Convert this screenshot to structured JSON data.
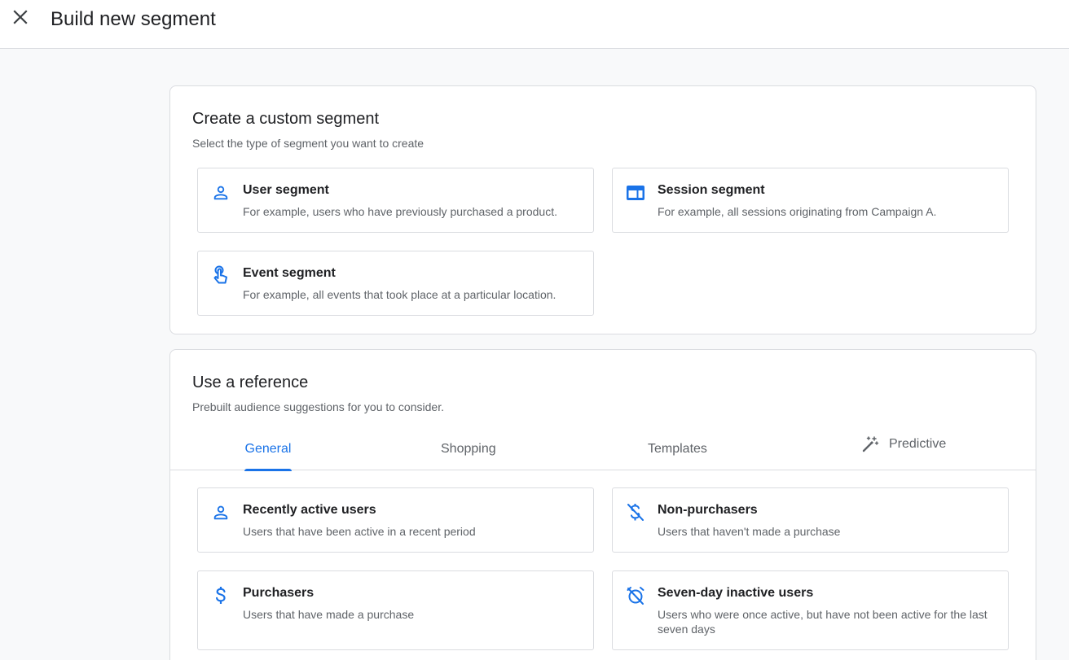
{
  "header": {
    "title": "Build new segment",
    "close_icon": "close-icon"
  },
  "custom": {
    "title": "Create a custom segment",
    "subtitle": "Select the type of segment you want to create",
    "options": [
      {
        "icon": "person-icon",
        "title": "User segment",
        "desc": "For example, users who have previously purchased a product."
      },
      {
        "icon": "web-window-icon",
        "title": "Session segment",
        "desc": "For example, all sessions originating from Campaign A."
      },
      {
        "icon": "touch-hand-icon",
        "title": "Event segment",
        "desc": "For example, all events that took place at a particular location."
      }
    ]
  },
  "reference": {
    "title": "Use a reference",
    "subtitle": "Prebuilt audience suggestions for you to consider.",
    "tabs": [
      {
        "label": "General",
        "active": true
      },
      {
        "label": "Shopping",
        "active": false
      },
      {
        "label": "Templates",
        "active": false
      },
      {
        "label": "Predictive",
        "active": false,
        "icon": "magic-wand-icon"
      }
    ],
    "options": [
      {
        "icon": "person-icon",
        "title": "Recently active users",
        "desc": "Users that have been active in a recent period"
      },
      {
        "icon": "money-off-icon",
        "title": "Non-purchasers",
        "desc": "Users that haven't made a purchase"
      },
      {
        "icon": "dollar-icon",
        "title": "Purchasers",
        "desc": "Users that have made a purchase"
      },
      {
        "icon": "alarm-off-icon",
        "title": "Seven-day inactive users",
        "desc": "Users who were once active, but have not been active for the last seven days"
      }
    ]
  },
  "colors": {
    "accent": "#1a73e8",
    "text_primary": "#202124",
    "text_secondary": "#5f6368",
    "border": "#dadce0",
    "page_bg": "#f8f9fa"
  }
}
